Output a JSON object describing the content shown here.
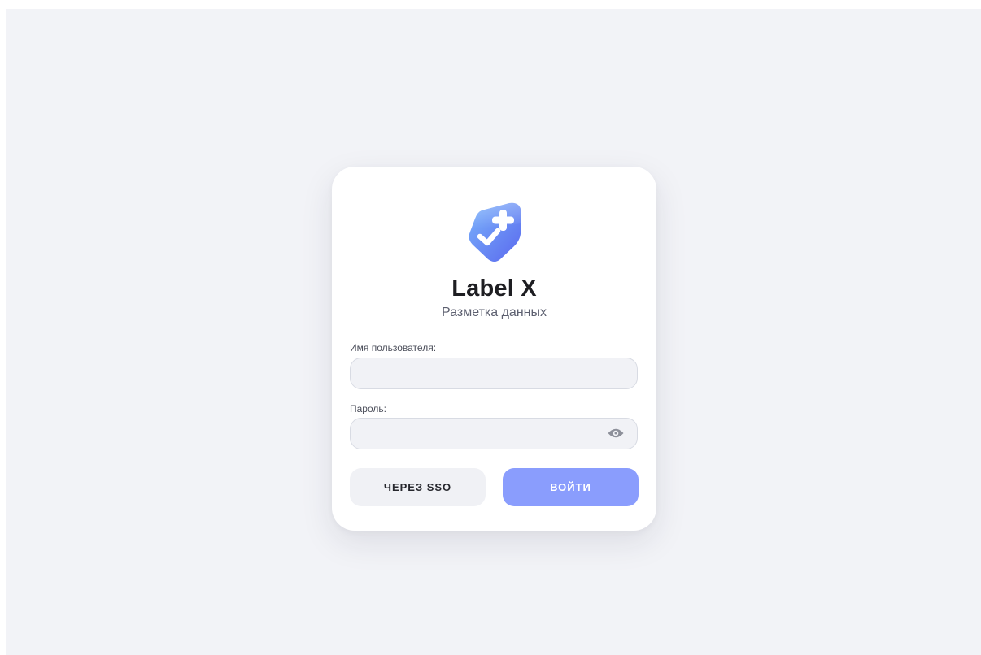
{
  "brand": {
    "title": "Label X",
    "subtitle": "Разметка данных",
    "logo_icon": "tag-plus-check-logo-icon"
  },
  "form": {
    "username": {
      "label": "Имя пользователя:",
      "value": "",
      "placeholder": ""
    },
    "password": {
      "label": "Пароль:",
      "value": "",
      "placeholder": "",
      "toggle_icon": "eye-icon"
    }
  },
  "actions": {
    "sso_label": "ЧЕРЕЗ SSO",
    "login_label": "ВОЙТИ"
  },
  "colors": {
    "page_background": "#f2f3f7",
    "card_background": "#ffffff",
    "accent": "#8a9dfd",
    "logo_gradient_start": "#7ab3fb",
    "logo_gradient_end": "#5b6ef2"
  }
}
